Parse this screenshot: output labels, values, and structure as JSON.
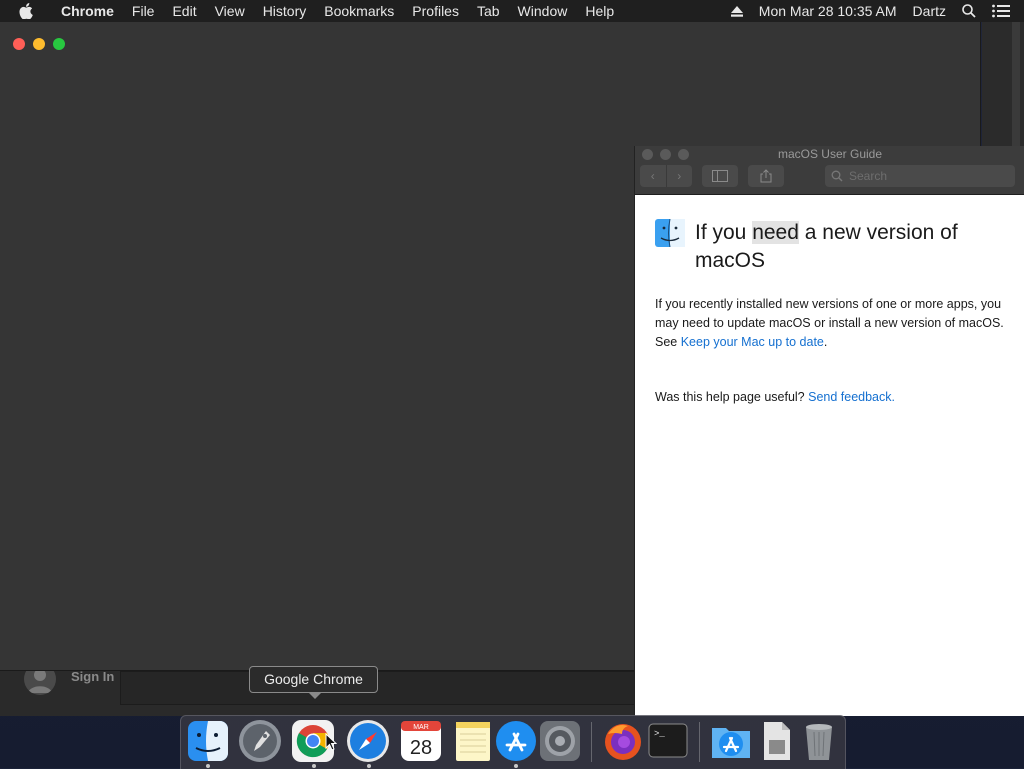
{
  "menubar": {
    "app_name": "Chrome",
    "items": [
      "File",
      "Edit",
      "View",
      "History",
      "Bookmarks",
      "Profiles",
      "Tab",
      "Window",
      "Help"
    ],
    "datetime": "Mon Mar 28  10:35 AM",
    "user": "Dartz",
    "icons": [
      "apple-icon",
      "eject-icon",
      "spotlight-search-icon",
      "notification-center-icon"
    ]
  },
  "chrome_window": {
    "traffic_lights": [
      "close",
      "minimize",
      "zoom"
    ],
    "sign_in_label": "Sign In"
  },
  "help_window": {
    "title": "macOS User Guide",
    "search_placeholder": "Search",
    "heading_before": "If you ",
    "heading_highlight": "need",
    "heading_after": " a new version of macOS",
    "paragraph_text": "If you recently installed new versions of one or more apps, you may need to update macOS or install a new version of macOS. See ",
    "paragraph_link": "Keep your Mac up to date",
    "paragraph_end": ".",
    "feedback_prompt": "Was this help page useful? ",
    "feedback_link": "Send feedback."
  },
  "tooltip": {
    "text": "Google Chrome"
  },
  "dock": {
    "items": [
      {
        "name": "Finder",
        "icon": "finder-icon",
        "running": true
      },
      {
        "name": "Launchpad",
        "icon": "launchpad-icon",
        "running": false
      },
      {
        "name": "Google Chrome",
        "icon": "chrome-icon",
        "running": true
      },
      {
        "name": "Safari",
        "icon": "safari-icon",
        "running": true
      },
      {
        "name": "Calendar",
        "icon": "calendar-icon",
        "running": false,
        "month": "MAR",
        "day": "28"
      },
      {
        "name": "Notes",
        "icon": "notes-icon",
        "running": false
      },
      {
        "name": "App Store",
        "icon": "app-store-icon",
        "running": true
      },
      {
        "name": "System Preferences",
        "icon": "system-preferences-icon",
        "running": false
      },
      {
        "name": "Firefox",
        "icon": "firefox-icon",
        "running": false
      },
      {
        "name": "Terminal",
        "icon": "terminal-icon",
        "running": false
      },
      {
        "name": "Applications",
        "icon": "applications-folder-icon",
        "running": false
      },
      {
        "name": "Document",
        "icon": "document-icon",
        "running": false
      },
      {
        "name": "Trash",
        "icon": "trash-icon",
        "running": false
      }
    ]
  },
  "colors": {
    "link": "#1570d0",
    "close": "#ff5f57",
    "minimize": "#febc2e",
    "zoom": "#28c840"
  }
}
